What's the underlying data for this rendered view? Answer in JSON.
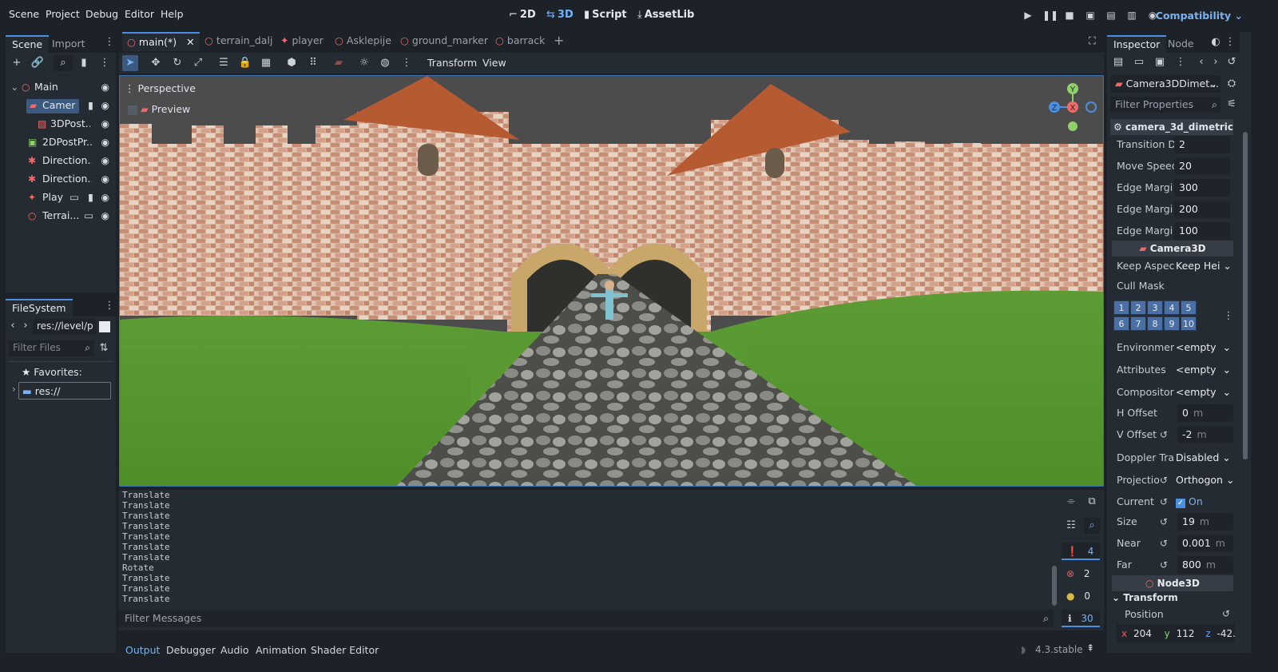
{
  "menu": [
    "Scene",
    "Project",
    "Debug",
    "Editor",
    "Help"
  ],
  "workspaces": [
    {
      "icon": "2d-icon",
      "label": "2D",
      "active": false
    },
    {
      "icon": "3d-icon",
      "label": "3D",
      "active": true
    },
    {
      "icon": "script-icon",
      "label": "Script",
      "active": false
    },
    {
      "icon": "assetlib-icon",
      "label": "AssetLib",
      "active": false
    }
  ],
  "renderer": "Compatibility",
  "scene_dock": {
    "tabs": [
      "Scene",
      "Import"
    ],
    "tree": [
      {
        "label": "Main",
        "icon": "node3d-icon"
      },
      {
        "label": "Camer",
        "icon": "camera-icon",
        "selected": true
      },
      {
        "label": "3DPost...",
        "icon": "post-icon"
      },
      {
        "label": "2DPostPr...",
        "icon": "post2d-icon"
      },
      {
        "label": "Direction...",
        "icon": "light-icon"
      },
      {
        "label": "Direction...",
        "icon": "light-icon"
      },
      {
        "label": "Play",
        "icon": "player-icon"
      },
      {
        "label": "Terrai...",
        "icon": "node3d-icon"
      }
    ]
  },
  "filesystem": {
    "title": "FileSystem",
    "path": "res://level/p",
    "filter_placeholder": "Filter Files",
    "favorites": "Favorites:",
    "root": "res://"
  },
  "editor_tabs": [
    "main(*)",
    "terrain_dalj",
    "player",
    "Asklepije",
    "ground_marker",
    "barrack"
  ],
  "viewport_toolbar": {
    "transform": "Transform",
    "view": "View"
  },
  "viewport": {
    "perspective": "Perspective",
    "preview": "Preview",
    "gizmo": {
      "y": "Y",
      "x": "X",
      "z": "Z"
    }
  },
  "output": {
    "lines": [
      "Translate",
      "Translate",
      "Translate",
      "Translate",
      "Translate",
      "Translate",
      "Translate",
      "Rotate",
      "Translate",
      "Translate",
      "Translate"
    ],
    "filter_placeholder": "Filter Messages",
    "counts": {
      "errors": "4",
      "warnings_err": "2",
      "warnings": "0",
      "info": "30"
    }
  },
  "bottom_tabs": [
    "Output",
    "Debugger",
    "Audio",
    "Animation",
    "Shader Editor"
  ],
  "version": "4.3.stable",
  "inspector": {
    "tabs": [
      "Inspector",
      "Node"
    ],
    "object": "Camera3DDimet...",
    "filter_placeholder": "Filter Properties",
    "script_header": "camera_3d_dimetric.gd",
    "script_props": [
      {
        "label": "Transition D",
        "value": "2"
      },
      {
        "label": "Move Speed",
        "value": "20"
      },
      {
        "label": "Edge Margi",
        "value": "300"
      },
      {
        "label": "Edge Margi",
        "value": "200"
      },
      {
        "label": "Edge Margi",
        "value": "100"
      }
    ],
    "camera_header": "Camera3D",
    "keep_aspect": {
      "label": "Keep Aspect",
      "value": "Keep Hei"
    },
    "cull_mask": {
      "label": "Cull Mask",
      "layers": [
        "1",
        "2",
        "3",
        "4",
        "5",
        "6",
        "7",
        "8",
        "9",
        "10"
      ]
    },
    "resources": [
      {
        "label": "Environmen",
        "value": "<empty"
      },
      {
        "label": "Attributes",
        "value": "<empty"
      },
      {
        "label": "Compositor",
        "value": "<empty"
      }
    ],
    "h_offset": {
      "label": "H Offset",
      "value": "0",
      "unit": "m"
    },
    "v_offset": {
      "label": "V Offset",
      "value": "-2",
      "unit": "m"
    },
    "doppler": {
      "label": "Doppler Tra",
      "value": "Disabled"
    },
    "projection": {
      "label": "Projectio",
      "value": "Orthogon"
    },
    "current": {
      "label": "Current",
      "value": "On"
    },
    "size": {
      "label": "Size",
      "value": "19",
      "unit": "m"
    },
    "near": {
      "label": "Near",
      "value": "0.001",
      "unit": "m"
    },
    "far": {
      "label": "Far",
      "value": "800",
      "unit": "m"
    },
    "node3d_header": "Node3D",
    "transform_header": "Transform",
    "position": {
      "label": "Position",
      "x_label": "x",
      "x": "204",
      "y_label": "y",
      "y": "112",
      "z_label": "z",
      "z": "-42."
    }
  }
}
